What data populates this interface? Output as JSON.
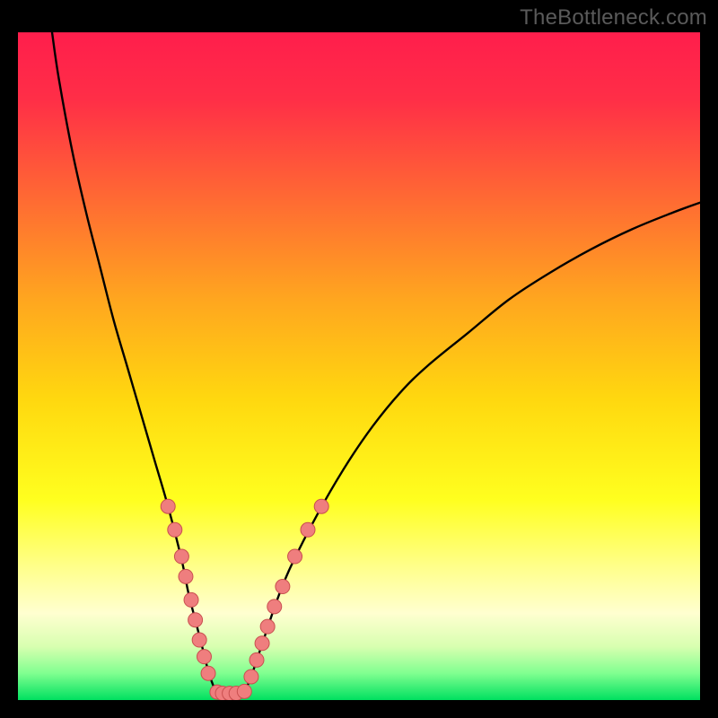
{
  "watermark": "TheBottleneck.com",
  "chart_data": {
    "type": "line",
    "title": "",
    "xlabel": "",
    "ylabel": "",
    "xlim": [
      0,
      100
    ],
    "ylim": [
      0,
      100
    ],
    "grid": false,
    "gradient_stops": [
      {
        "offset": 0.0,
        "color": "#ff1e4c"
      },
      {
        "offset": 0.1,
        "color": "#ff2e47"
      },
      {
        "offset": 0.25,
        "color": "#ff6a33"
      },
      {
        "offset": 0.4,
        "color": "#ffa61f"
      },
      {
        "offset": 0.55,
        "color": "#ffd80f"
      },
      {
        "offset": 0.7,
        "color": "#ffff1f"
      },
      {
        "offset": 0.8,
        "color": "#ffff8a"
      },
      {
        "offset": 0.87,
        "color": "#ffffd0"
      },
      {
        "offset": 0.92,
        "color": "#d8ffb0"
      },
      {
        "offset": 0.96,
        "color": "#80ff90"
      },
      {
        "offset": 1.0,
        "color": "#00e060"
      }
    ],
    "series": [
      {
        "name": "left-arm",
        "stroke": "#000000",
        "x": [
          5,
          6,
          8,
          10,
          12,
          14,
          16,
          18,
          20,
          22,
          24,
          25,
          26,
          27,
          28,
          29
        ],
        "y": [
          100,
          93,
          82,
          73,
          65,
          57,
          50,
          43,
          36,
          29,
          21,
          16,
          12,
          8,
          4,
          1.2
        ]
      },
      {
        "name": "valley-floor",
        "stroke": "#000000",
        "x": [
          29,
          30,
          31,
          32,
          33
        ],
        "y": [
          1.2,
          1.0,
          1.0,
          1.0,
          1.2
        ]
      },
      {
        "name": "right-arm",
        "stroke": "#000000",
        "x": [
          33,
          34,
          36,
          38,
          40,
          44,
          48,
          52,
          56,
          60,
          66,
          72,
          78,
          84,
          90,
          96,
          100
        ],
        "y": [
          1.2,
          3,
          9,
          15,
          20,
          28,
          35,
          41,
          46,
          50,
          55,
          60,
          64,
          67.5,
          70.5,
          73,
          74.5
        ]
      }
    ],
    "markers": {
      "color": "#ef7e7e",
      "stroke": "#c94f4f",
      "radius_px": 8,
      "points": [
        {
          "x": 22.0,
          "y": 29.0
        },
        {
          "x": 23.0,
          "y": 25.5
        },
        {
          "x": 24.0,
          "y": 21.5
        },
        {
          "x": 24.6,
          "y": 18.5
        },
        {
          "x": 25.4,
          "y": 15.0
        },
        {
          "x": 26.0,
          "y": 12.0
        },
        {
          "x": 26.6,
          "y": 9.0
        },
        {
          "x": 27.3,
          "y": 6.5
        },
        {
          "x": 27.9,
          "y": 4.0
        },
        {
          "x": 29.2,
          "y": 1.2
        },
        {
          "x": 30.0,
          "y": 1.0
        },
        {
          "x": 31.0,
          "y": 1.0
        },
        {
          "x": 32.0,
          "y": 1.0
        },
        {
          "x": 33.2,
          "y": 1.3
        },
        {
          "x": 34.2,
          "y": 3.5
        },
        {
          "x": 35.0,
          "y": 6.0
        },
        {
          "x": 35.8,
          "y": 8.5
        },
        {
          "x": 36.6,
          "y": 11.0
        },
        {
          "x": 37.6,
          "y": 14.0
        },
        {
          "x": 38.8,
          "y": 17.0
        },
        {
          "x": 40.6,
          "y": 21.5
        },
        {
          "x": 42.5,
          "y": 25.5
        },
        {
          "x": 44.5,
          "y": 29.0
        }
      ]
    }
  }
}
